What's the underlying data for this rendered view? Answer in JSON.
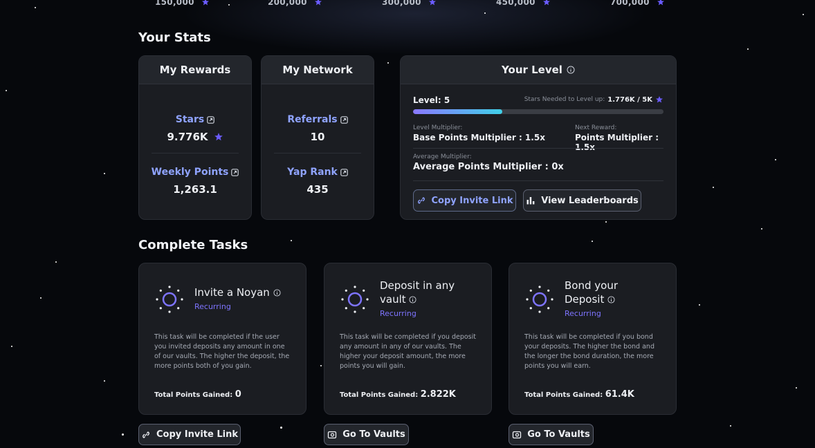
{
  "milestones": [
    "150,000",
    "200,000",
    "300,000",
    "450,000",
    "700,000"
  ],
  "sections": {
    "stats_title": "Your Stats",
    "tasks_title": "Complete Tasks"
  },
  "rewards": {
    "title": "My Rewards",
    "stars_label": "Stars",
    "stars_value": "9.776K",
    "weekly_label": "Weekly Points",
    "weekly_value": "1,263.1"
  },
  "network": {
    "title": "My Network",
    "referrals_label": "Referrals",
    "referrals_value": "10",
    "yap_label": "Yap Rank",
    "yap_value": "435"
  },
  "level": {
    "title": "Your Level",
    "level_text": "Level: 5",
    "stars_needed_label": "Stars Needed to Level up:",
    "stars_needed_value": "1.776K / 5K",
    "progress": 0.355,
    "level_multiplier_label": "Level Multiplier:",
    "level_multiplier_value": "Base Points Multiplier : 1.5x",
    "next_reward_label": "Next Reward:",
    "next_reward_value": "Points Multiplier : 1.5x",
    "average_label": "Average Multiplier:",
    "average_value": "Average Points Multiplier : 0x",
    "copy_invite_label": "Copy Invite Link",
    "leaderboards_label": "View Leaderboards"
  },
  "tasks": [
    {
      "title_line1": "Invite a Noyan",
      "title_line2": "",
      "recurring": "Recurring",
      "description": "This task will be completed if the user you invited deposits any amount in one of our vaults. The higher the deposit, the more points both of you gain.",
      "total_label": "Total Points Gained:",
      "total_value": "0",
      "button_label": "Copy Invite Link"
    },
    {
      "title_line1": "Deposit in any",
      "title_line2": "vault",
      "recurring": "Recurring",
      "description": "This task will be completed if you deposit any amount in any of our vaults. The higher your deposit amount, the more points you will gain.",
      "total_label": "Total Points Gained:",
      "total_value": "2.822K",
      "button_label": "Go To Vaults"
    },
    {
      "title_line1": "Bond your",
      "title_line2": "Deposit",
      "recurring": "Recurring",
      "description": "This task will be completed if you bond your deposits. The higher the bond and the longer the bond duration, the more points you will earn.",
      "total_label": "Total Points Gained:",
      "total_value": "61.4K",
      "button_label": "Go To Vaults"
    }
  ],
  "colors": {
    "accent": "#8fa3ff",
    "recurring": "#7e74ff",
    "card_bg": "#1b1d22",
    "page_bg": "#06080c"
  },
  "icons": [
    "star-icon",
    "external-link-icon",
    "info-icon",
    "link-icon",
    "bar-chart-icon",
    "vault-icon",
    "task-spinner-icon"
  ]
}
